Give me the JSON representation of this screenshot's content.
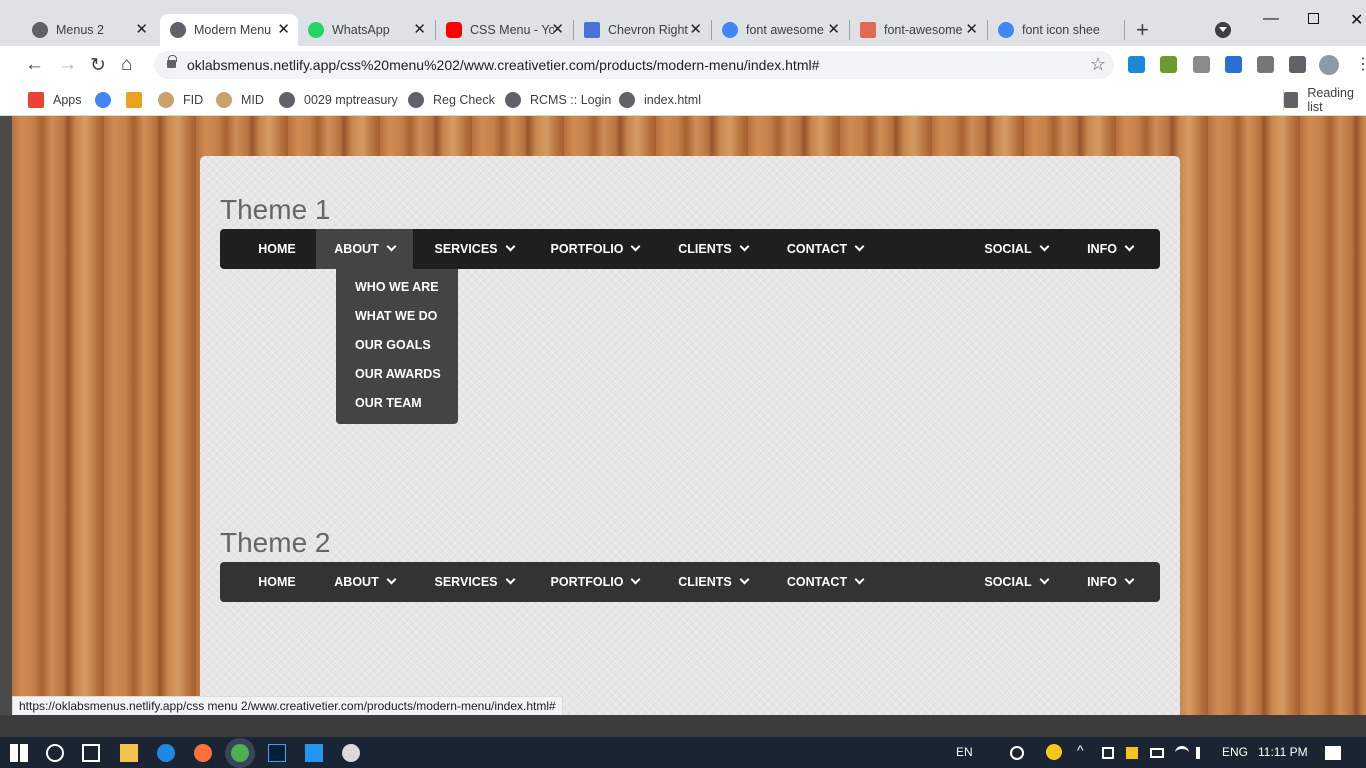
{
  "browser": {
    "tabs": [
      {
        "title": "Menus 2",
        "favicon_color": "#5f6368"
      },
      {
        "title": "Modern Menu",
        "favicon_color": "#5f6368"
      },
      {
        "title": "WhatsApp",
        "favicon_color": "#25d366"
      },
      {
        "title": "CSS Menu - Yo",
        "favicon_color": "#ff0000"
      },
      {
        "title": "Chevron Right",
        "favicon_color": "#4a72d9"
      },
      {
        "title": "font awesome",
        "favicon_color": "#4285f4"
      },
      {
        "title": "font-awesome",
        "favicon_color": "#e06a4e"
      },
      {
        "title": "font icon shee",
        "favicon_color": "#4285f4"
      }
    ],
    "new_tab_icon": "+",
    "url": "oklabsmenus.netlify.app/css%20menu%202/www.creativetier.com/products/modern-menu/index.html#",
    "bookmarks": [
      "Apps",
      "",
      "",
      "FID",
      "MID",
      "0029 mptreasury",
      "Reg Check",
      "RCMS :: Login",
      "index.html"
    ],
    "reading_list": "Reading list",
    "status_url": "https://oklabsmenus.netlify.app/css menu 2/www.creativetier.com/products/modern-menu/index.html#"
  },
  "page": {
    "theme1": {
      "title": "Theme 1"
    },
    "theme2": {
      "title": "Theme 2"
    },
    "menu": [
      {
        "label": "HOME",
        "has_chevron": false
      },
      {
        "label": "ABOUT",
        "has_chevron": true
      },
      {
        "label": "SERVICES",
        "has_chevron": true
      },
      {
        "label": "PORTFOLIO",
        "has_chevron": true
      },
      {
        "label": "CLIENTS",
        "has_chevron": true
      },
      {
        "label": "CONTACT",
        "has_chevron": true
      },
      {
        "label": "SOCIAL",
        "has_chevron": true
      },
      {
        "label": "INFO",
        "has_chevron": true
      }
    ],
    "about_dropdown": [
      "WHO WE ARE",
      "WHAT WE DO",
      "OUR GOALS",
      "OUR AWARDS",
      "OUR TEAM"
    ]
  },
  "taskbar": {
    "lang_en": "EN",
    "lang_eng": "ENG",
    "time": "11:11 PM"
  },
  "colors": {
    "menubar_theme1": "#1f1f1f",
    "menubar_theme2": "#333333",
    "dropdown_bg": "#444444"
  }
}
